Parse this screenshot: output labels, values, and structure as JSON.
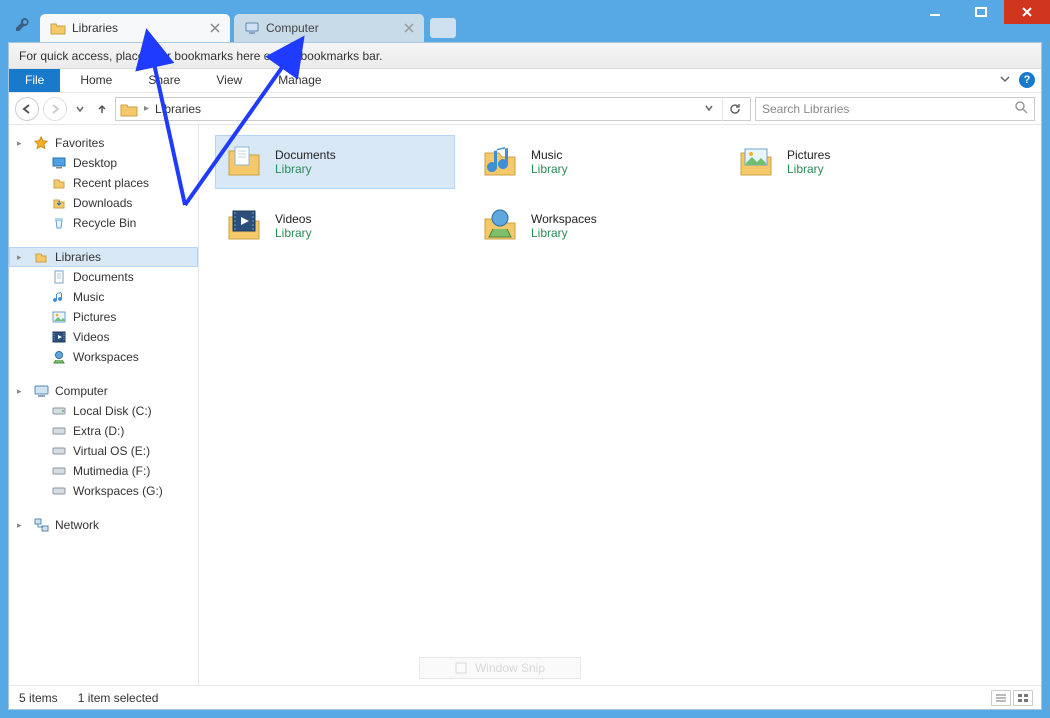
{
  "window": {
    "tabs": [
      {
        "label": "Libraries",
        "active": true
      },
      {
        "label": "Computer",
        "active": false
      }
    ]
  },
  "bookmarks_hint": "For quick access, place your bookmarks here on the bookmarks bar.",
  "ribbon": {
    "file": "File",
    "tabs": [
      "Home",
      "Share",
      "View",
      "Manage"
    ]
  },
  "address": {
    "crumb": "Libraries",
    "search_placeholder": "Search Libraries"
  },
  "sidebar": {
    "favorites": {
      "label": "Favorites",
      "items": [
        "Desktop",
        "Recent places",
        "Downloads",
        "Recycle Bin"
      ]
    },
    "libraries": {
      "label": "Libraries",
      "selected": true,
      "items": [
        "Documents",
        "Music",
        "Pictures",
        "Videos",
        "Workspaces"
      ]
    },
    "computer": {
      "label": "Computer",
      "items": [
        "Local Disk (C:)",
        "Extra (D:)",
        "Virtual OS (E:)",
        "Mutimedia (F:)",
        "Workspaces (G:)"
      ]
    },
    "network": {
      "label": "Network"
    }
  },
  "main": {
    "sublabel": "Library",
    "items": [
      {
        "name": "Documents",
        "selected": true,
        "icon": "documents"
      },
      {
        "name": "Music",
        "icon": "music"
      },
      {
        "name": "Pictures",
        "icon": "pictures"
      },
      {
        "name": "Videos",
        "icon": "videos"
      },
      {
        "name": "Workspaces",
        "icon": "workspaces"
      }
    ]
  },
  "status": {
    "count": "5 items",
    "selected": "1 item selected"
  },
  "ghost_button": "Window Snip"
}
